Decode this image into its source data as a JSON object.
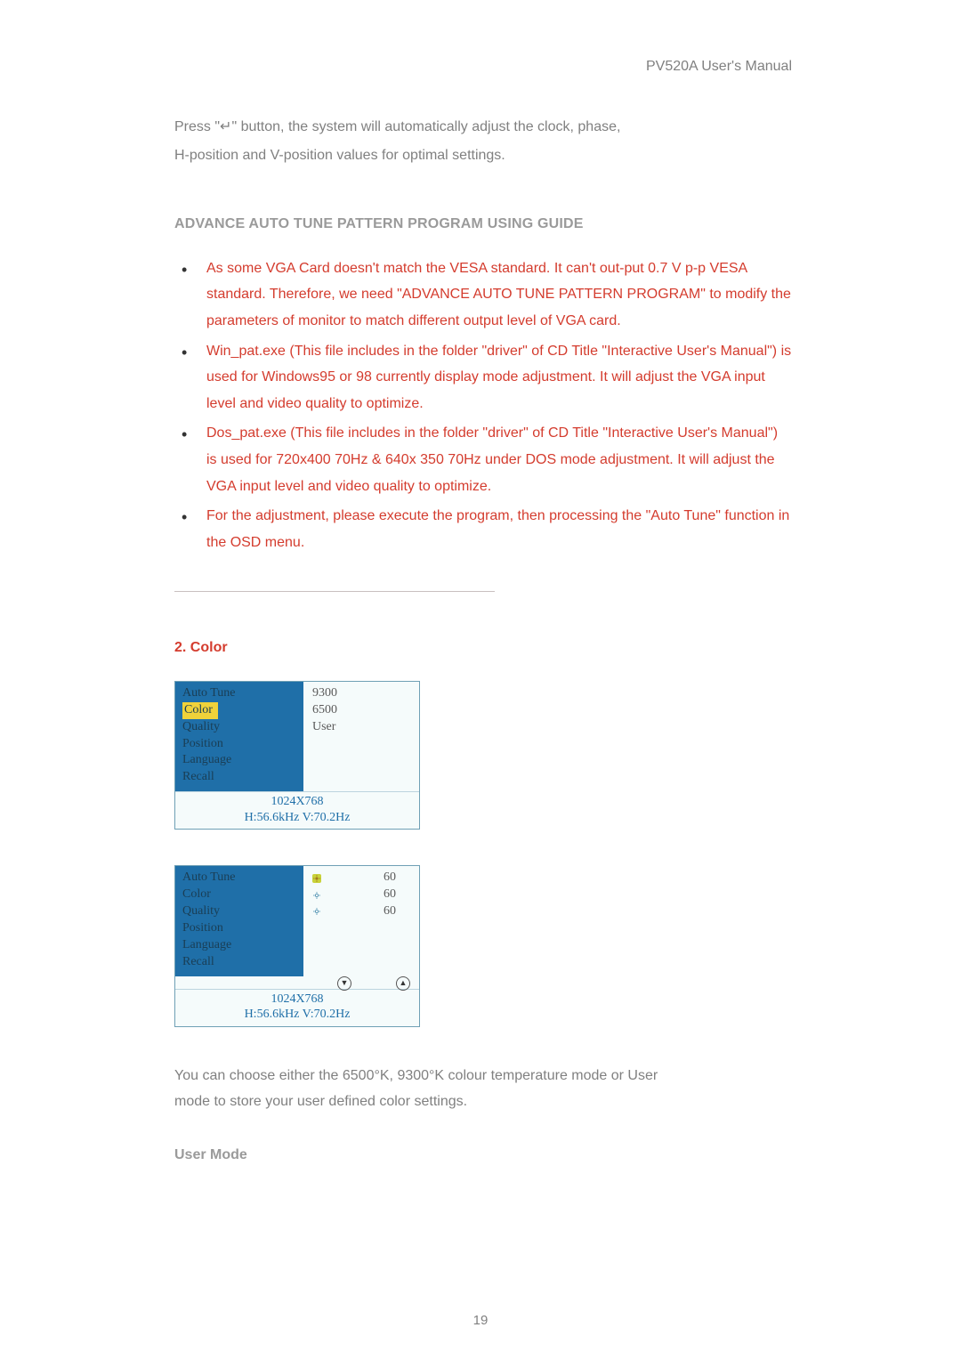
{
  "header": {
    "title": "PV520A User's Manual"
  },
  "intro": {
    "line1_prefix": "Press \"",
    "enter_symbol": "↵",
    "line1_suffix": "\" button, the system will automatically adjust the clock, phase,",
    "line2": "H-position and V-position values for optimal settings."
  },
  "advance_title": "ADVANCE AUTO TUNE PATTERN PROGRAM USING GUIDE",
  "bullets": [
    "As some VGA Card doesn't match the VESA standard. It can't out-put 0.7 V p-p VESA standard. Therefore, we need \"ADVANCE AUTO TUNE PATTERN PROGRAM\" to modify the parameters of monitor to match different output level of VGA card.",
    "Win_pat.exe (This file includes in the folder \"driver\" of CD Title \"Interactive User's Manual\") is used for Windows95 or 98 currently display mode adjustment. It will adjust the VGA input level and video quality to optimize.",
    "Dos_pat.exe (This file includes in the folder \"driver\" of CD Title \"Interactive User's Manual\") is used for 720x400 70Hz & 640x 350 70Hz under DOS mode adjustment. It will adjust the VGA input level and video quality to optimize.",
    "For the adjustment, please execute the program, then processing the \"Auto Tune\" function in the OSD menu."
  ],
  "section2": {
    "title": "2. Color"
  },
  "osd_menu": {
    "left_items": [
      "Auto Tune",
      "Color",
      "Quality",
      "Position",
      "Language",
      "Recall"
    ],
    "selected_index": 1,
    "foot_res": "1024X768",
    "foot_freq": "H:56.6kHz V:70.2Hz"
  },
  "osd1_right": [
    "9300",
    "6500",
    "User"
  ],
  "osd2_right": [
    {
      "value": "60",
      "selected": true
    },
    {
      "value": "60",
      "selected": false
    },
    {
      "value": "60",
      "selected": false
    }
  ],
  "outro": {
    "line1": "You can choose either the 6500°K, 9300°K colour temperature mode or User",
    "line2": "mode to store your user defined color settings."
  },
  "user_mode_label": "User Mode",
  "page_number": "19"
}
